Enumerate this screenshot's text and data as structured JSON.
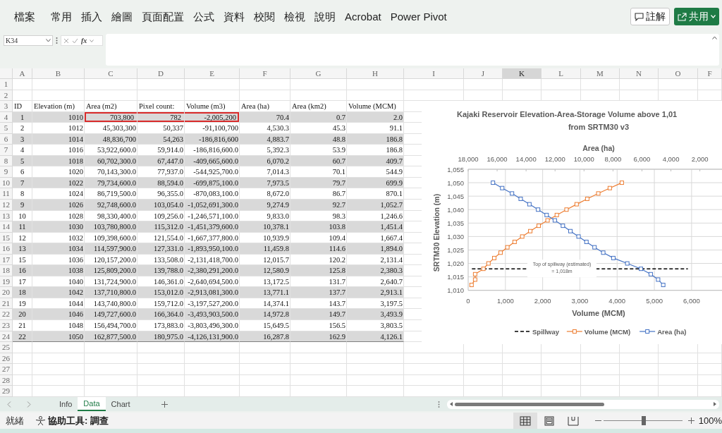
{
  "ribbon": {
    "tabs": [
      "檔案",
      "常用",
      "插入",
      "繪圖",
      "頁面配置",
      "公式",
      "資料",
      "校閱",
      "檢視",
      "說明",
      "Acrobat",
      "Power Pivot"
    ],
    "buttons": [
      {
        "label": "註解",
        "kind": "comment"
      },
      {
        "label": "共用",
        "kind": "share"
      }
    ]
  },
  "formula_bar": {
    "name_box": "K34",
    "function_label": "fx"
  },
  "sheet": {
    "columns": [
      {
        "label": "A",
        "selected": false
      },
      {
        "label": "B",
        "selected": false
      },
      {
        "label": "C",
        "selected": false
      },
      {
        "label": "D",
        "selected": false
      },
      {
        "label": "E",
        "selected": false
      },
      {
        "label": "F",
        "selected": false
      },
      {
        "label": "G",
        "selected": false
      },
      {
        "label": "H",
        "selected": false
      },
      {
        "label": "I",
        "selected": false
      },
      {
        "label": "J",
        "selected": false
      },
      {
        "label": "K",
        "selected": true
      },
      {
        "label": "L",
        "selected": false
      },
      {
        "label": "M",
        "selected": false
      },
      {
        "label": "N",
        "selected": false
      },
      {
        "label": "O",
        "selected": false
      },
      {
        "label": "F",
        "selected": false
      }
    ],
    "rows": [
      {
        "number": "1",
        "kind": "empty"
      },
      {
        "number": "2",
        "kind": "empty"
      },
      {
        "number": "3",
        "kind": "header",
        "cells": [
          "ID",
          "Elevation (m)",
          "Area (m2)",
          "Pixel count:",
          "Volume (m3)",
          "Area (ha)",
          "Area (km2)",
          "Volume (MCM)"
        ]
      },
      {
        "number": "4",
        "kind": "data",
        "shaded": true,
        "outlined": [
          false,
          false,
          true,
          true,
          true,
          false,
          false,
          false
        ],
        "cells": [
          "1",
          "1010",
          "703,800",
          "782",
          "-2,005,200",
          "70.4",
          "0.7",
          "2.0"
        ]
      },
      {
        "number": "5",
        "kind": "data",
        "shaded": false,
        "outlined": [
          false,
          false,
          false,
          false,
          false,
          false,
          false,
          false
        ],
        "cells": [
          "2",
          "1012",
          "45,303,300",
          "50,337",
          "-91,100,700",
          "4,530.3",
          "45.3",
          "91.1"
        ]
      },
      {
        "number": "6",
        "kind": "data",
        "shaded": true,
        "outlined": [
          false,
          false,
          false,
          false,
          false,
          false,
          false,
          false
        ],
        "cells": [
          "3",
          "1014",
          "48,836,700",
          "54,263",
          "-186,816,600",
          "4,883.7",
          "48.8",
          "186.8"
        ]
      },
      {
        "number": "7",
        "kind": "data",
        "shaded": false,
        "outlined": [
          false,
          false,
          false,
          false,
          false,
          false,
          false,
          false
        ],
        "cells": [
          "4",
          "1016",
          "53,922,600.0",
          "59,914.0",
          "-186,816,600.0",
          "5,392.3",
          "53.9",
          "186.8"
        ]
      },
      {
        "number": "8",
        "kind": "data",
        "shaded": true,
        "outlined": [
          false,
          false,
          false,
          false,
          false,
          false,
          false,
          false
        ],
        "cells": [
          "5",
          "1018",
          "60,702,300.0",
          "67,447.0",
          "-409,665,600.0",
          "6,070.2",
          "60.7",
          "409.7"
        ]
      },
      {
        "number": "9",
        "kind": "data",
        "shaded": false,
        "outlined": [
          false,
          false,
          false,
          false,
          false,
          false,
          false,
          false
        ],
        "cells": [
          "6",
          "1020",
          "70,143,300.0",
          "77,937.0",
          "-544,925,700.0",
          "7,014.3",
          "70.1",
          "544.9"
        ]
      },
      {
        "number": "10",
        "kind": "data",
        "shaded": true,
        "outlined": [
          false,
          false,
          false,
          false,
          false,
          false,
          false,
          false
        ],
        "cells": [
          "7",
          "1022",
          "79,734,600.0",
          "88,594.0",
          "-699,875,100.0",
          "7,973.5",
          "79.7",
          "699.9"
        ]
      },
      {
        "number": "11",
        "kind": "data",
        "shaded": false,
        "outlined": [
          false,
          false,
          false,
          false,
          false,
          false,
          false,
          false
        ],
        "cells": [
          "8",
          "1024",
          "86,719,500.0",
          "96,355.0",
          "-870,083,100.0",
          "8,672.0",
          "86.7",
          "870.1"
        ]
      },
      {
        "number": "12",
        "kind": "data",
        "shaded": true,
        "outlined": [
          false,
          false,
          false,
          false,
          false,
          false,
          false,
          false
        ],
        "cells": [
          "9",
          "1026",
          "92,748,600.0",
          "103,054.0",
          "-1,052,691,300.0",
          "9,274.9",
          "92.7",
          "1,052.7"
        ]
      },
      {
        "number": "13",
        "kind": "data",
        "shaded": false,
        "outlined": [
          false,
          false,
          false,
          false,
          false,
          false,
          false,
          false
        ],
        "cells": [
          "10",
          "1028",
          "98,330,400.0",
          "109,256.0",
          "-1,246,571,100.0",
          "9,833.0",
          "98.3",
          "1,246.6"
        ]
      },
      {
        "number": "14",
        "kind": "data",
        "shaded": true,
        "outlined": [
          false,
          false,
          false,
          false,
          false,
          false,
          false,
          false
        ],
        "cells": [
          "11",
          "1030",
          "103,780,800.0",
          "115,312.0",
          "-1,451,379,600.0",
          "10,378.1",
          "103.8",
          "1,451.4"
        ]
      },
      {
        "number": "15",
        "kind": "data",
        "shaded": false,
        "outlined": [
          false,
          false,
          false,
          false,
          false,
          false,
          false,
          false
        ],
        "cells": [
          "12",
          "1032",
          "109,398,600.0",
          "121,554.0",
          "-1,667,377,800.0",
          "10,939.9",
          "109.4",
          "1,667.4"
        ]
      },
      {
        "number": "16",
        "kind": "data",
        "shaded": true,
        "outlined": [
          false,
          false,
          false,
          false,
          false,
          false,
          false,
          false
        ],
        "cells": [
          "13",
          "1034",
          "114,597,900.0",
          "127,331.0",
          "-1,893,950,100.0",
          "11,459.8",
          "114.6",
          "1,894.0"
        ]
      },
      {
        "number": "17",
        "kind": "data",
        "shaded": false,
        "outlined": [
          false,
          false,
          false,
          false,
          false,
          false,
          false,
          false
        ],
        "cells": [
          "15",
          "1036",
          "120,157,200.0",
          "133,508.0",
          "-2,131,418,700.0",
          "12,015.7",
          "120.2",
          "2,131.4"
        ]
      },
      {
        "number": "18",
        "kind": "data",
        "shaded": true,
        "outlined": [
          false,
          false,
          false,
          false,
          false,
          false,
          false,
          false
        ],
        "cells": [
          "16",
          "1038",
          "125,809,200.0",
          "139,788.0",
          "-2,380,291,200.0",
          "12,580.9",
          "125.8",
          "2,380.3"
        ]
      },
      {
        "number": "19",
        "kind": "data",
        "shaded": false,
        "outlined": [
          false,
          false,
          false,
          false,
          false,
          false,
          false,
          false
        ],
        "cells": [
          "17",
          "1040",
          "131,724,900.0",
          "146,361.0",
          "-2,640,694,500.0",
          "13,172.5",
          "131.7",
          "2,640.7"
        ]
      },
      {
        "number": "20",
        "kind": "data",
        "shaded": true,
        "outlined": [
          false,
          false,
          false,
          false,
          false,
          false,
          false,
          false
        ],
        "cells": [
          "18",
          "1042",
          "137,710,800.0",
          "153,012.0",
          "-2,913,081,300.0",
          "13,771.1",
          "137.7",
          "2,913.1"
        ]
      },
      {
        "number": "21",
        "kind": "data",
        "shaded": false,
        "outlined": [
          false,
          false,
          false,
          false,
          false,
          false,
          false,
          false
        ],
        "cells": [
          "19",
          "1044",
          "143,740,800.0",
          "159,712.0",
          "-3,197,527,200.0",
          "14,374.1",
          "143.7",
          "3,197.5"
        ]
      },
      {
        "number": "22",
        "kind": "data",
        "shaded": true,
        "outlined": [
          false,
          false,
          false,
          false,
          false,
          false,
          false,
          false
        ],
        "cells": [
          "20",
          "1046",
          "149,727,600.0",
          "166,364.0",
          "-3,493,903,500.0",
          "14,972.8",
          "149.7",
          "3,493.9"
        ]
      },
      {
        "number": "23",
        "kind": "data",
        "shaded": false,
        "outlined": [
          false,
          false,
          false,
          false,
          false,
          false,
          false,
          false
        ],
        "cells": [
          "21",
          "1048",
          "156,494,700.0",
          "173,883.0",
          "-3,803,496,300.0",
          "15,649.5",
          "156.5",
          "3,803.5"
        ]
      },
      {
        "number": "24",
        "kind": "data",
        "shaded": true,
        "outlined": [
          false,
          false,
          false,
          false,
          false,
          false,
          false,
          false
        ],
        "cells": [
          "22",
          "1050",
          "162,877,500.0",
          "180,975.0",
          "-4,126,131,900.0",
          "16,287.8",
          "162.9",
          "4,126.1"
        ]
      },
      {
        "number": "25",
        "kind": "empty"
      },
      {
        "number": "26",
        "kind": "empty"
      },
      {
        "number": "27",
        "kind": "empty"
      },
      {
        "number": "28",
        "kind": "empty"
      },
      {
        "number": "29",
        "kind": "empty"
      }
    ]
  },
  "chart": {
    "chart_data": {
      "type": "scatter",
      "title": "Kajaki Reservoir Elevation-Area-Storage Volume above 1,01",
      "subtitle": "from SRTM30 v3",
      "xlabel": "Volume (MCM)",
      "x2label": "Area (ha)",
      "ylabel": "SRTM30 Elevation (m)",
      "grid": true,
      "legend": true,
      "xlim": [
        0,
        7000
      ],
      "x2lim": [
        18000,
        0
      ],
      "ylim": [
        1010,
        1055
      ],
      "xticks": [
        {
          "value": 0,
          "label": "0"
        },
        {
          "value": 1000,
          "label": "1,000"
        },
        {
          "value": 2000,
          "label": "2,000"
        },
        {
          "value": 3000,
          "label": "3,000"
        },
        {
          "value": 4000,
          "label": "4,000"
        },
        {
          "value": 5000,
          "label": "5,000"
        },
        {
          "value": 6000,
          "label": "6,000"
        }
      ],
      "x2ticks": [
        {
          "value": 18000,
          "label": "18,000"
        },
        {
          "value": 16000,
          "label": "16,000"
        },
        {
          "value": 14000,
          "label": "14,000"
        },
        {
          "value": 12000,
          "label": "12,000"
        },
        {
          "value": 10000,
          "label": "10,000"
        },
        {
          "value": 8000,
          "label": "8,000"
        },
        {
          "value": 6000,
          "label": "6,000"
        },
        {
          "value": 4000,
          "label": "4,000"
        },
        {
          "value": 2000,
          "label": "2,000"
        }
      ],
      "yticks": [
        {
          "value": 1010,
          "label": "1,010"
        },
        {
          "value": 1015,
          "label": "1,015"
        },
        {
          "value": 1020,
          "label": "1,020"
        },
        {
          "value": 1025,
          "label": "1,025"
        },
        {
          "value": 1030,
          "label": "1,030"
        },
        {
          "value": 1035,
          "label": "1,035"
        },
        {
          "value": 1040,
          "label": "1,040"
        },
        {
          "value": 1045,
          "label": "1,045"
        },
        {
          "value": 1050,
          "label": "1,050"
        },
        {
          "value": 1055,
          "label": "1,055"
        }
      ],
      "series": [
        {
          "name": "Spillway",
          "color": "#000000",
          "type": "line",
          "line_style": "dashed",
          "marker": "none",
          "x": [
            100,
            5900
          ],
          "values": [
            1018,
            1018
          ]
        },
        {
          "name": "Volume (MCM)",
          "color": "#ed7d31",
          "type": "line",
          "line_style": "solid",
          "marker": "square",
          "x": [
            91.1,
            186.8,
            186.8,
            409.7,
            544.9,
            699.9,
            870.1,
            1052.7,
            1246.6,
            1451.4,
            1667.4,
            1894.0,
            2131.4,
            2380.3,
            2640.7,
            2913.1,
            3197.5,
            3493.9,
            3803.5,
            4126.1
          ],
          "values": [
            1012,
            1014,
            1016,
            1018,
            1020,
            1022,
            1024,
            1026,
            1028,
            1030,
            1032,
            1034,
            1036,
            1038,
            1040,
            1042,
            1044,
            1046,
            1048,
            1050
          ]
        },
        {
          "name": "Area (ha)",
          "color": "#4472c4",
          "type": "line",
          "line_style": "solid",
          "marker": "square",
          "axis": "x2",
          "x": [
            4530.3,
            4883.7,
            5392.3,
            6070.2,
            7014.3,
            7973.5,
            8672.0,
            9274.9,
            9833.0,
            10378.1,
            10939.9,
            11459.8,
            12015.7,
            12580.9,
            13172.5,
            13771.1,
            14374.1,
            14972.8,
            15649.5,
            16287.8
          ],
          "values": [
            1012,
            1014,
            1016,
            1018,
            1020,
            1022,
            1024,
            1026,
            1028,
            1030,
            1032,
            1034,
            1036,
            1038,
            1040,
            1042,
            1044,
            1046,
            1048,
            1050
          ]
        }
      ],
      "annotations": [
        "Top of spillway (estimated)",
        "= 1,018m"
      ]
    }
  },
  "sheet_tabs": [
    {
      "label": "Info",
      "selected": false
    },
    {
      "label": "Data",
      "selected": true
    },
    {
      "label": "Chart",
      "selected": false
    }
  ],
  "status_bar": {
    "status": "就緒",
    "accessibility": "協助工具: 調查",
    "views": [
      {
        "kind": "normal",
        "selected": true
      },
      {
        "kind": "page_layout",
        "selected": false
      },
      {
        "kind": "page_break",
        "selected": false
      }
    ],
    "zoom_slider": {
      "level": 0.51
    },
    "zoom": "100%"
  }
}
